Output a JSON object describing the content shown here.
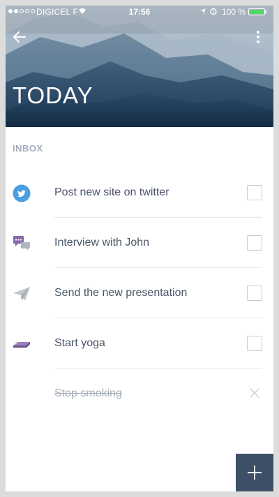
{
  "status_bar": {
    "carrier": "DIGICEL F",
    "time": "17:56",
    "battery_percent": "100 %",
    "battery_level": 1.0
  },
  "header": {
    "title": "TODAY",
    "back_icon": "arrow-left-icon",
    "more_icon": "more-vertical-icon"
  },
  "section": {
    "label": "INBOX"
  },
  "tasks": [
    {
      "label": "Post new site on twitter",
      "icon": "twitter-icon",
      "completed": false
    },
    {
      "label": "Interview with John",
      "icon": "chat-bubbles-icon",
      "completed": false
    },
    {
      "label": "Send the new presentation",
      "icon": "paper-plane-icon",
      "completed": false
    },
    {
      "label": "Start yoga",
      "icon": "yoga-mat-icon",
      "completed": false
    },
    {
      "label": "Stop smoking",
      "icon": "none",
      "completed": true
    }
  ],
  "fab": {
    "icon": "plus-icon"
  },
  "colors": {
    "accent_twitter": "#4a9fe0",
    "accent_purple": "#8a6aa8",
    "fab": "#3e5068",
    "text": "#4a5668",
    "muted": "#a5aebd"
  }
}
